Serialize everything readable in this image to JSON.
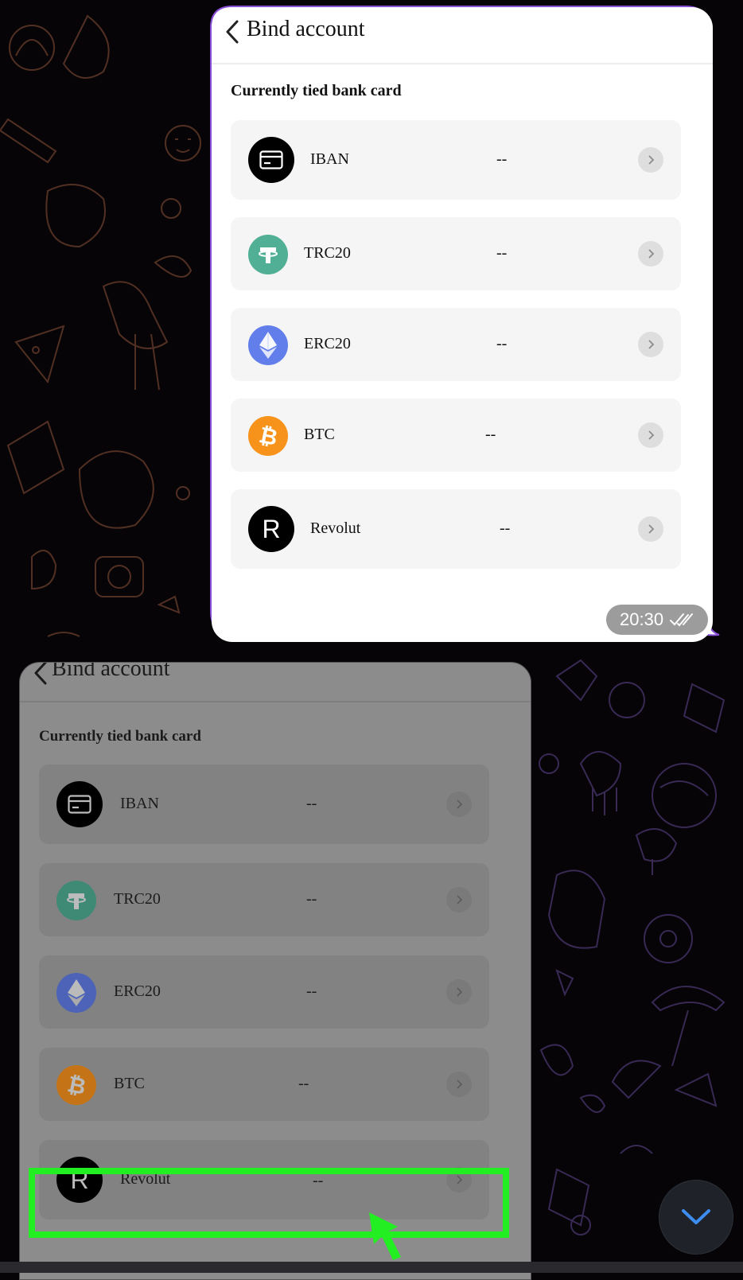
{
  "sent_message": {
    "app_title": "Bind account",
    "section_title": "Currently tied bank card",
    "rows": [
      {
        "label": "IBAN",
        "value": "--",
        "icon": "card-icon"
      },
      {
        "label": "TRC20",
        "value": "--",
        "icon": "tether-icon"
      },
      {
        "label": "ERC20",
        "value": "--",
        "icon": "ethereum-icon"
      },
      {
        "label": "BTC",
        "value": "--",
        "icon": "bitcoin-icon"
      },
      {
        "label": "Revolut",
        "value": "--",
        "icon": "revolut-icon"
      }
    ],
    "time": "20:30",
    "read_status_icon": "double-check-icon"
  },
  "received_message": {
    "app_title": "Bind account",
    "section_title": "Currently tied bank card",
    "rows": [
      {
        "label": "IBAN",
        "value": "--",
        "icon": "card-icon"
      },
      {
        "label": "TRC20",
        "value": "--",
        "icon": "tether-icon"
      },
      {
        "label": "ERC20",
        "value": "--",
        "icon": "ethereum-icon"
      },
      {
        "label": "BTC",
        "value": "--",
        "icon": "bitcoin-icon"
      },
      {
        "label": "Revolut",
        "value": "--",
        "icon": "revolut-icon"
      }
    ],
    "highlighted_row": "Revolut"
  },
  "colors": {
    "bubble_border": "#8a4fd8",
    "highlight": "#22ee22",
    "tether": "#50af95",
    "ethereum": "#627eea",
    "bitcoin": "#f7931a",
    "fab_chevron": "#3d8cf0"
  },
  "scroll_down_icon": "chevron-down-icon"
}
